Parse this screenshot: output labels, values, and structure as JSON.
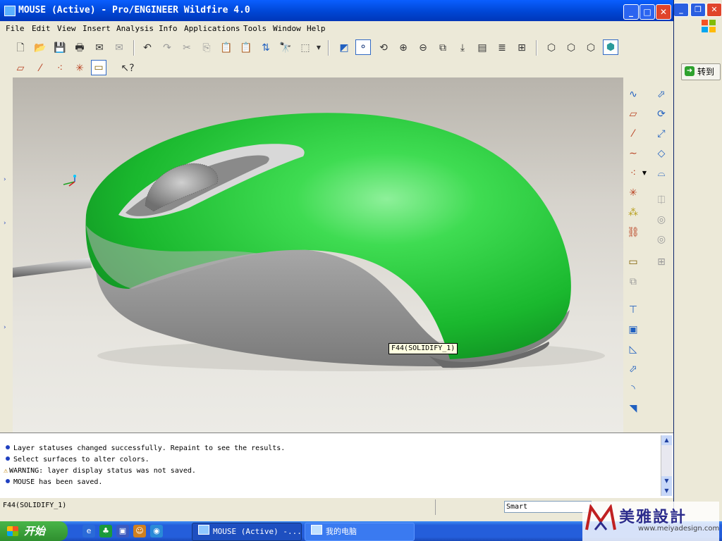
{
  "window": {
    "title": "MOUSE (Active) - Pro/ENGINEER Wildfire 4.0",
    "controls": {
      "minimize": "_",
      "maximize": "□",
      "close": "✕"
    }
  },
  "menu": {
    "items": [
      "File",
      "Edit",
      "View",
      "Insert",
      "Analysis",
      "Info",
      "Applications",
      "Tools",
      "Window",
      "Help"
    ]
  },
  "viewport": {
    "tooltip": "F44(SOLIDIFY_1)"
  },
  "messages": [
    {
      "icon": "info",
      "text": "Layer statuses changed successfully. Repaint to see the results."
    },
    {
      "icon": "info",
      "text": "Select surfaces to alter colors."
    },
    {
      "icon": "warning",
      "text": "WARNING: layer display status was not saved."
    },
    {
      "icon": "info",
      "text": "MOUSE has been saved."
    }
  ],
  "statusbar": {
    "selection": "F44(SOLIDIFY_1)",
    "filter": "Smart"
  },
  "background_window": {
    "goto_label": "转到"
  },
  "taskbar": {
    "start_label": "开始",
    "tasks": [
      {
        "label": "MOUSE (Active) -..."
      },
      {
        "label": "我的电脑"
      }
    ]
  },
  "watermark": {
    "name": "美雅設計",
    "url": "www.meiyadesign.com"
  },
  "colors": {
    "model_green": "#22cc3a",
    "model_gray": "#9a9a9a",
    "titlebar": "#0046d5",
    "taskbar": "#245edb"
  }
}
